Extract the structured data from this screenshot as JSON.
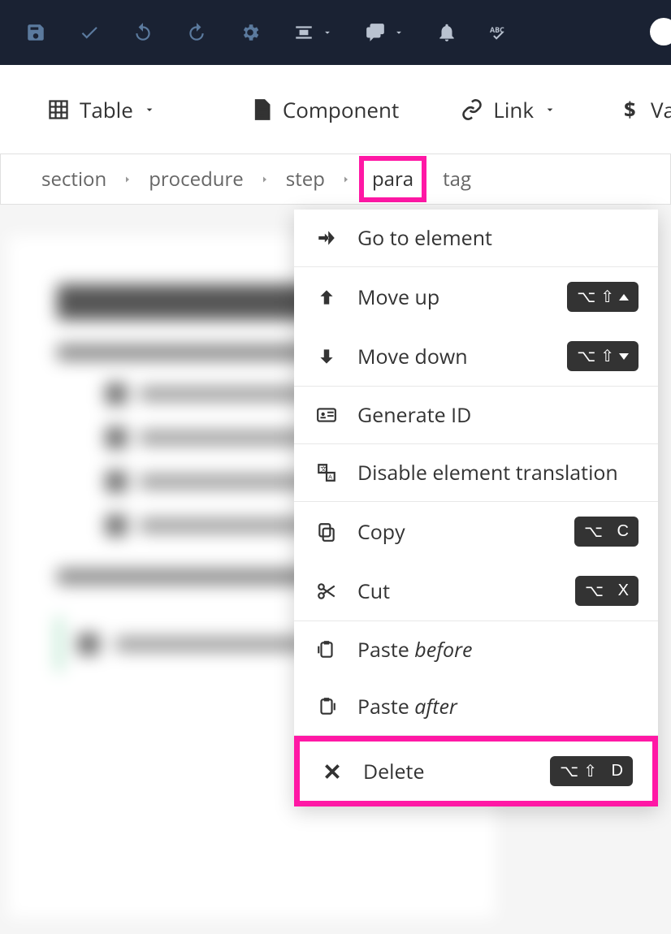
{
  "toolbar": {
    "table_label": "Table",
    "component_label": "Component",
    "link_label": "Link",
    "variable_label": "Variable"
  },
  "breadcrumb": {
    "items": [
      "section",
      "procedure",
      "step",
      "para",
      "tag"
    ],
    "highlighted": "para"
  },
  "menu": {
    "go_to_element": "Go to element",
    "move_up": "Move up",
    "move_down": "Move down",
    "generate_id": "Generate ID",
    "disable_translation": "Disable element translation",
    "copy": "Copy",
    "cut": "Cut",
    "paste_before_pre": "Paste ",
    "paste_before_em": "before",
    "paste_after_pre": "Paste ",
    "paste_after_em": "after",
    "delete": "Delete",
    "sc_opt": "⌥",
    "sc_shift": "⇧",
    "sc_c": "C",
    "sc_x": "X",
    "sc_d": "D"
  }
}
